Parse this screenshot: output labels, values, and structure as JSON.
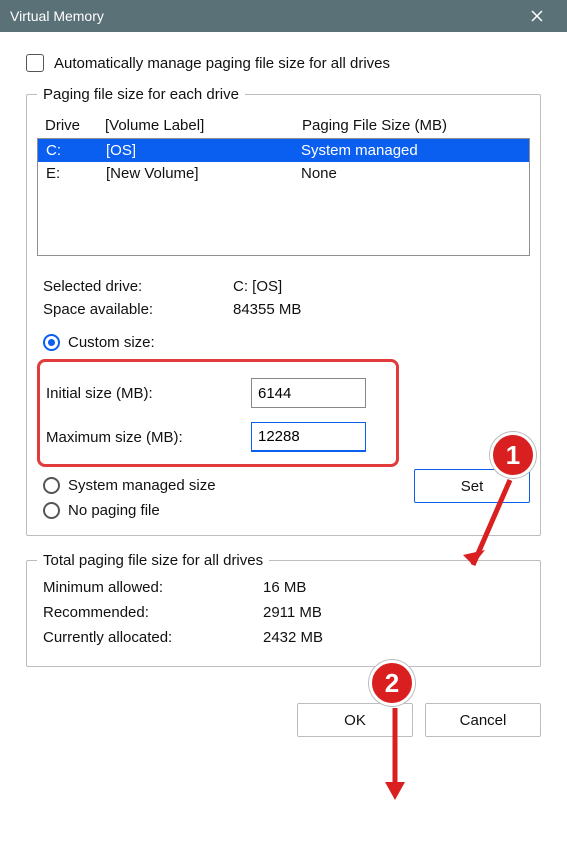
{
  "title": "Virtual Memory",
  "auto_manage_label": "Automatically manage paging file size for all drives",
  "group1_legend": "Paging file size for each drive",
  "headers": {
    "drive": "Drive",
    "label": "[Volume Label]",
    "size": "Paging File Size (MB)"
  },
  "drives": [
    {
      "letter": "C:",
      "label": "[OS]",
      "size": "System managed"
    },
    {
      "letter": "E:",
      "label": "[New Volume]",
      "size": "None"
    }
  ],
  "selected_drive_label": "Selected drive:",
  "selected_drive_value": "C:  [OS]",
  "space_avail_label": "Space available:",
  "space_avail_value": "84355 MB",
  "custom_size_label": "Custom size:",
  "initial_label": "Initial size (MB):",
  "initial_value": "6144",
  "maximum_label": "Maximum size (MB):",
  "maximum_value": "12288",
  "system_managed_label": "System managed size",
  "no_paging_label": "No paging file",
  "set_label": "Set",
  "group2_legend": "Total paging file size for all drives",
  "min_allowed_label": "Minimum allowed:",
  "min_allowed_value": "16 MB",
  "recommended_label": "Recommended:",
  "recommended_value": "2911 MB",
  "current_label": "Currently allocated:",
  "current_value": "2432 MB",
  "ok_label": "OK",
  "cancel_label": "Cancel",
  "badge1": "1",
  "badge2": "2"
}
